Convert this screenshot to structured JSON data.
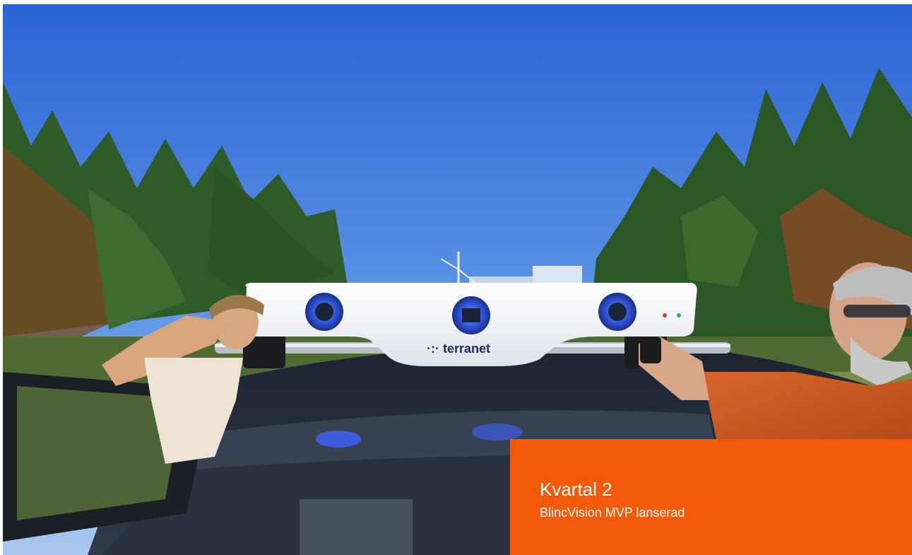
{
  "caption": {
    "title": "Kvartal 2",
    "subtitle": "BlincVision MVP lanserad"
  },
  "photo": {
    "brand_label": "terranet",
    "subject": "roof-mounted-sensor-on-car"
  },
  "colors": {
    "accent": "#f55a0a",
    "sky": "#2f6fd6"
  }
}
